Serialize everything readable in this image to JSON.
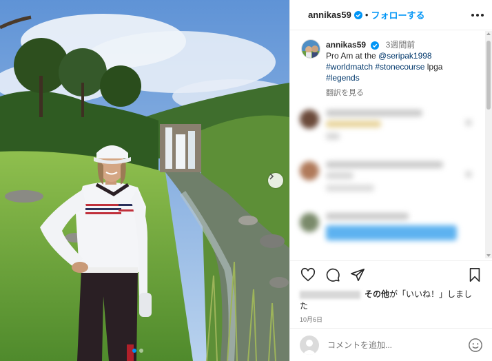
{
  "post": {
    "username": "annikas59",
    "separator": "•",
    "follow_label": "フォローする",
    "time_ago": "3週間前",
    "caption_prefix": "Pro Am at the ",
    "mention": "@seripak1998",
    "hashtags": [
      "#worldmatch",
      "#stonecourse",
      "lpga",
      "#legends"
    ],
    "translate_label": "翻訳を見る",
    "likes_suffix_1": "その他",
    "likes_suffix_2": "が「いいね！」しまし",
    "likes_suffix_3": "た",
    "date": "10月6日",
    "comment_placeholder": "コメントを追加..."
  },
  "icons": {
    "verified": "verified-badge-icon",
    "more": "more-options-icon",
    "like": "heart-icon",
    "comment": "comment-icon",
    "share": "share-icon",
    "save": "bookmark-icon",
    "emoji": "emoji-icon",
    "next": "chevron-right-icon"
  },
  "colors": {
    "accent": "#0095f6",
    "hashtag": "#00376b",
    "muted": "#737373"
  }
}
